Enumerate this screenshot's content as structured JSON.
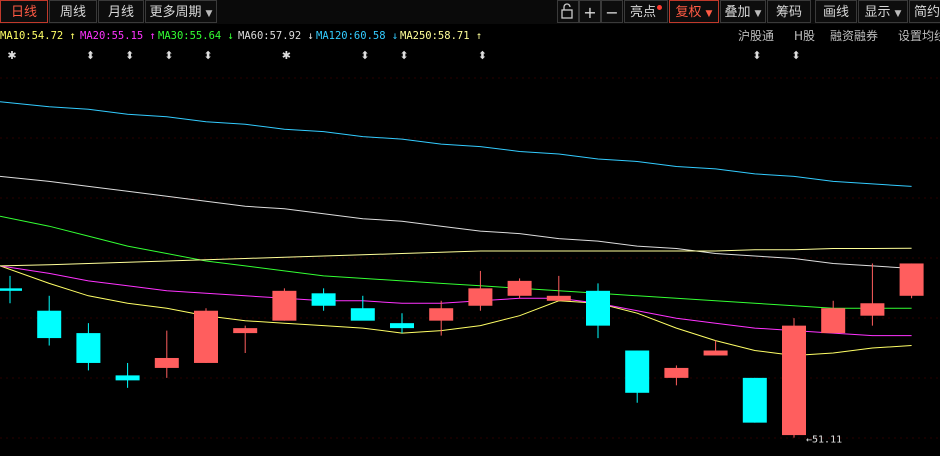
{
  "toolbar": {
    "tabs": [
      "日线",
      "周线",
      "月线"
    ],
    "more_periods": "更多周期",
    "lock_icon": "lock-icon",
    "plus": "+",
    "minus": "−",
    "highlight": "亮点",
    "restore_rights": "复权",
    "overlay": "叠加",
    "chips": "筹码",
    "draw_line": "画线",
    "display": "显示",
    "simple_mode": "简约"
  },
  "ma_labels": [
    {
      "text": "MA10:54.72",
      "arrow": "↑",
      "color": "#ffff66"
    },
    {
      "text": "MA20:55.15",
      "arrow": "↑",
      "color": "#ff33ff"
    },
    {
      "text": "MA30:55.64",
      "arrow": "↓",
      "color": "#33ff33"
    },
    {
      "text": "MA60:57.92",
      "arrow": "↓",
      "color": "#dddddd"
    },
    {
      "text": "MA120:60.58",
      "arrow": "↓",
      "color": "#33ccff"
    },
    {
      "text": "MA250:58.71",
      "arrow": "↑",
      "color": "#ffff99"
    }
  ],
  "right_links": [
    "沪股通",
    "H股",
    "融资融券",
    "设置均线"
  ],
  "event_markers": [
    "✱",
    "⬍",
    "⬍",
    "⬍",
    "⬍",
    "✱",
    "⬍",
    "⬍",
    "⬍",
    "⬍",
    "⬍"
  ],
  "min_label": "←51.11",
  "colors": {
    "up": "#ff5e5e",
    "down": "#00ffff",
    "background": "#000000"
  },
  "chart_data": {
    "type": "candlestick",
    "ylim": [
      50.6,
      66.2
    ],
    "candles": [
      {
        "o": 57.1,
        "h": 57.6,
        "l": 56.5,
        "c": 57.0
      },
      {
        "o": 56.2,
        "h": 56.8,
        "l": 54.8,
        "c": 55.1
      },
      {
        "o": 55.3,
        "h": 55.7,
        "l": 53.8,
        "c": 54.1
      },
      {
        "o": 53.6,
        "h": 54.1,
        "l": 53.1,
        "c": 53.4
      },
      {
        "o": 53.9,
        "h": 55.4,
        "l": 53.5,
        "c": 54.3
      },
      {
        "o": 54.1,
        "h": 56.3,
        "l": 54.1,
        "c": 56.2
      },
      {
        "o": 55.3,
        "h": 55.6,
        "l": 54.5,
        "c": 55.5
      },
      {
        "o": 55.8,
        "h": 57.1,
        "l": 55.8,
        "c": 57.0
      },
      {
        "o": 56.9,
        "h": 57.1,
        "l": 56.2,
        "c": 56.4
      },
      {
        "o": 56.3,
        "h": 56.8,
        "l": 55.9,
        "c": 55.8
      },
      {
        "o": 55.7,
        "h": 56.1,
        "l": 55.3,
        "c": 55.5
      },
      {
        "o": 55.8,
        "h": 56.6,
        "l": 55.2,
        "c": 56.3
      },
      {
        "o": 56.4,
        "h": 57.8,
        "l": 56.2,
        "c": 57.1
      },
      {
        "o": 56.8,
        "h": 57.5,
        "l": 56.7,
        "c": 57.4
      },
      {
        "o": 56.6,
        "h": 57.6,
        "l": 56.6,
        "c": 56.8
      },
      {
        "o": 57.0,
        "h": 57.3,
        "l": 55.1,
        "c": 55.6
      },
      {
        "o": 54.6,
        "h": 54.6,
        "l": 52.5,
        "c": 52.9
      },
      {
        "o": 53.5,
        "h": 54.0,
        "l": 53.2,
        "c": 53.9
      },
      {
        "o": 54.4,
        "h": 55.0,
        "l": 54.4,
        "c": 54.6
      },
      {
        "o": 53.5,
        "h": 53.5,
        "l": 51.7,
        "c": 51.7
      },
      {
        "o": 51.2,
        "h": 55.9,
        "l": 51.1,
        "c": 55.6
      },
      {
        "o": 55.3,
        "h": 56.6,
        "l": 55.3,
        "c": 56.3
      },
      {
        "o": 56.0,
        "h": 58.1,
        "l": 55.6,
        "c": 56.5
      },
      {
        "o": 56.8,
        "h": 58.1,
        "l": 56.7,
        "c": 58.1
      }
    ],
    "ma_series": [
      {
        "name": "MA10",
        "color": "#ffff66",
        "values": [
          58.0,
          57.3,
          56.8,
          56.5,
          56.3,
          56.0,
          55.8,
          55.7,
          55.6,
          55.5,
          55.3,
          55.4,
          55.6,
          56.0,
          56.6,
          56.5,
          56.1,
          55.5,
          55.0,
          54.6,
          54.4,
          54.5,
          54.7,
          54.8
        ]
      },
      {
        "name": "MA20",
        "color": "#ff33ff",
        "values": [
          58.0,
          57.7,
          57.4,
          57.2,
          57.0,
          56.9,
          56.8,
          56.7,
          56.6,
          56.6,
          56.5,
          56.5,
          56.6,
          56.7,
          56.7,
          56.5,
          56.2,
          55.9,
          55.7,
          55.5,
          55.4,
          55.3,
          55.2,
          55.2
        ]
      },
      {
        "name": "MA30",
        "color": "#33ff33",
        "values": [
          60.0,
          59.6,
          59.2,
          58.8,
          58.5,
          58.2,
          58.0,
          57.8,
          57.6,
          57.5,
          57.4,
          57.3,
          57.2,
          57.1,
          57.0,
          56.9,
          56.8,
          56.7,
          56.6,
          56.5,
          56.4,
          56.3,
          56.3,
          56.3
        ]
      },
      {
        "name": "MA60",
        "color": "#dddddd",
        "values": [
          61.6,
          61.4,
          61.2,
          61.0,
          60.8,
          60.6,
          60.4,
          60.3,
          60.1,
          59.9,
          59.8,
          59.6,
          59.4,
          59.3,
          59.1,
          59.0,
          58.8,
          58.7,
          58.5,
          58.4,
          58.3,
          58.1,
          58.0,
          57.9
        ]
      },
      {
        "name": "MA120",
        "color": "#33ccff",
        "values": [
          64.6,
          64.4,
          64.3,
          64.1,
          64.0,
          63.8,
          63.7,
          63.5,
          63.4,
          63.2,
          63.1,
          62.9,
          62.8,
          62.6,
          62.5,
          62.3,
          62.2,
          62.0,
          61.9,
          61.7,
          61.6,
          61.4,
          61.3,
          61.2
        ]
      },
      {
        "name": "MA250",
        "color": "#ffff99",
        "values": [
          58.0,
          58.05,
          58.1,
          58.15,
          58.2,
          58.25,
          58.3,
          58.35,
          58.4,
          58.45,
          58.5,
          58.55,
          58.6,
          58.6,
          58.6,
          58.6,
          58.6,
          58.6,
          58.6,
          58.65,
          58.65,
          58.7,
          58.7,
          58.71
        ]
      }
    ]
  }
}
